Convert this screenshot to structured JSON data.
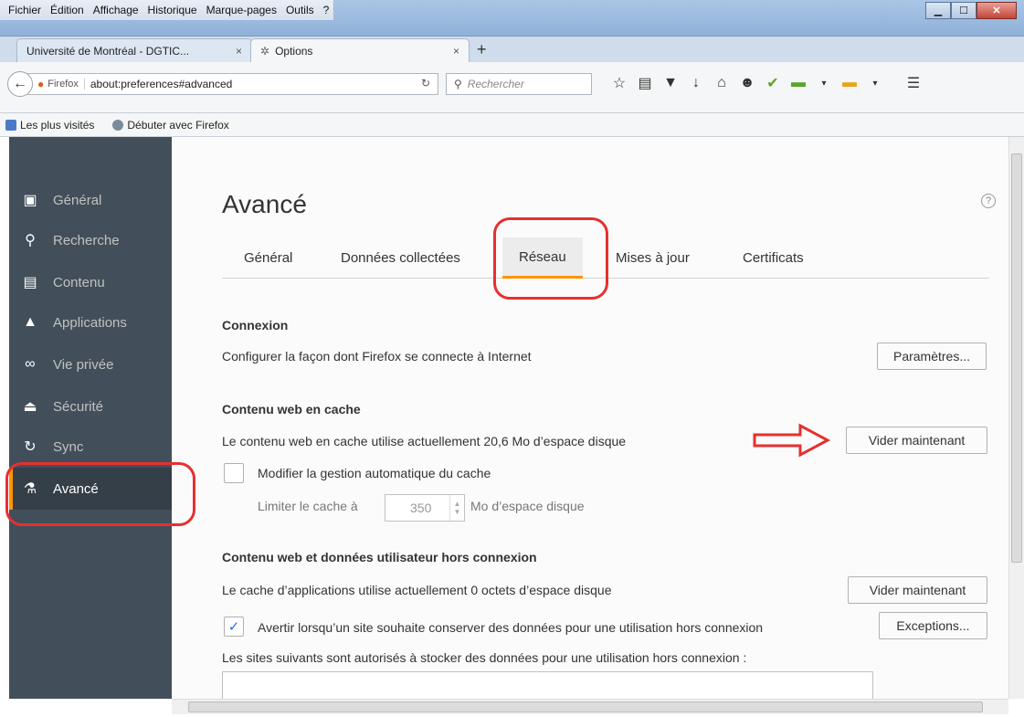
{
  "menubar": {
    "items": [
      "Fichier",
      "Édition",
      "Affichage",
      "Historique",
      "Marque-pages",
      "Outils",
      "?"
    ]
  },
  "tabs": [
    {
      "label": "Université de Montréal - DGTIC...",
      "close": "×"
    },
    {
      "label": "Options",
      "close": "×"
    }
  ],
  "newtab": "+",
  "navbar": {
    "firefox_label": "Firefox",
    "url": "about:preferences#advanced",
    "search_placeholder": "Rechercher"
  },
  "bookmarks": {
    "most_visited": "Les plus visités",
    "getting_started": "Débuter avec Firefox"
  },
  "sidebar": {
    "items": [
      {
        "label": "Général",
        "icon": "general-icon"
      },
      {
        "label": "Recherche",
        "icon": "search-icon"
      },
      {
        "label": "Contenu",
        "icon": "content-icon"
      },
      {
        "label": "Applications",
        "icon": "applications-icon"
      },
      {
        "label": "Vie privée",
        "icon": "privacy-icon"
      },
      {
        "label": "Sécurité",
        "icon": "security-icon"
      },
      {
        "label": "Sync",
        "icon": "sync-icon"
      },
      {
        "label": "Avancé",
        "icon": "advanced-icon"
      }
    ],
    "selected": "Avancé"
  },
  "main": {
    "title": "Avancé",
    "help": "?",
    "tabs": [
      "Général",
      "Données collectées",
      "Réseau",
      "Mises à jour",
      "Certificats"
    ],
    "active_tab": "Réseau",
    "connection": {
      "heading": "Connexion",
      "text": "Configurer la façon dont Firefox se connecte à Internet",
      "button": "Paramètres..."
    },
    "cache": {
      "heading": "Contenu web en cache",
      "text": "Le contenu web en cache utilise actuellement 20,6 Mo d’espace disque",
      "button": "Vider maintenant",
      "override_label": "Modifier la gestion automatique du cache",
      "override_checked": false,
      "limit_label": "Limiter le cache à",
      "limit_value": "350",
      "limit_unit": "Mo d’espace disque"
    },
    "offline": {
      "heading": "Contenu web et données utilisateur hors connexion",
      "text": "Le cache d’applications utilise actuellement 0 octets d’espace disque",
      "button": "Vider maintenant",
      "warn_label": "Avertir lorsqu’un site souhaite conserver des données pour une utilisation hors connexion",
      "warn_checked": true,
      "exceptions_button": "Exceptions...",
      "allowed_text": "Les sites suivants sont autorisés à stocker des données pour une utilisation hors connexion :"
    }
  },
  "colors": {
    "accent": "#ff9500",
    "sidebar_bg": "#424f5a",
    "annotation_red": "#e53030"
  }
}
